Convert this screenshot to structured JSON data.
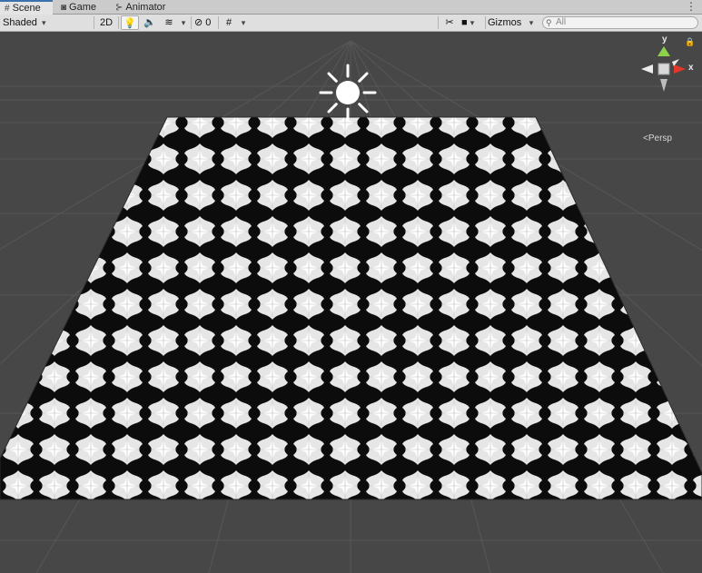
{
  "tabs": [
    {
      "label": "Scene",
      "icon": "scene-grid-icon",
      "active": true
    },
    {
      "label": "Game",
      "icon": "gamepad-icon",
      "active": false
    },
    {
      "label": "Animator",
      "icon": "animator-icon",
      "active": false
    }
  ],
  "toolbar": {
    "draw_mode": "Shaded",
    "mode_2d": "2D",
    "hidden_count": "0",
    "gizmos_label": "Gizmos",
    "search_placeholder": "All"
  },
  "viewport": {
    "projection_label": "Persp",
    "gizmo_axis_y": "y",
    "gizmo_axis_x": "x"
  },
  "colors": {
    "viewport_bg": "#474747",
    "gizmo_y": "#8dd24a",
    "gizmo_x": "#e0392b",
    "active_tab_accent": "#3a72b0"
  }
}
